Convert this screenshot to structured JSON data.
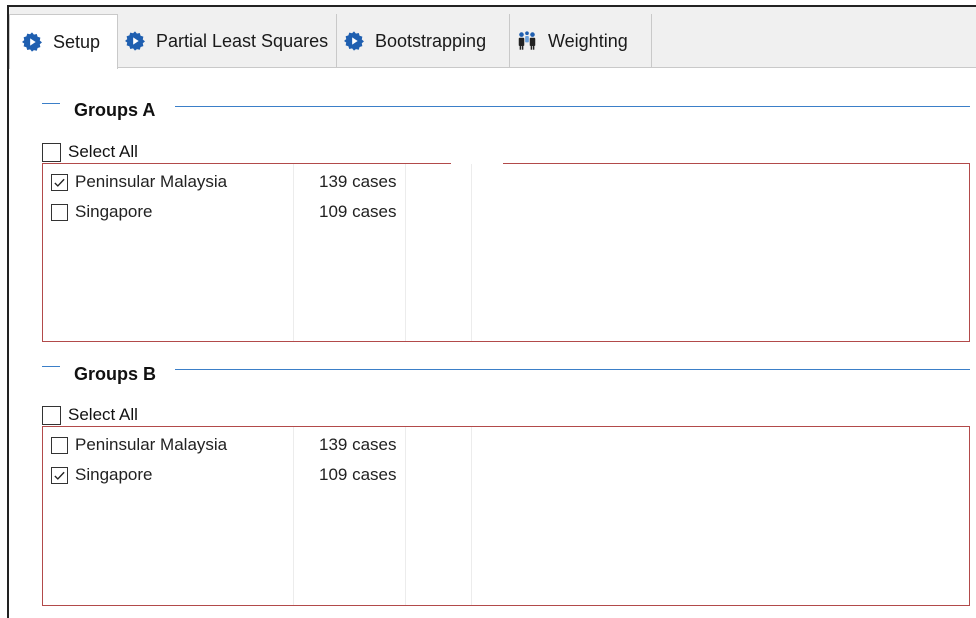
{
  "tabs": [
    {
      "label": "Setup",
      "icon": "gear-icon",
      "active": true
    },
    {
      "label": "Partial Least Squares",
      "icon": "gear-icon",
      "active": false
    },
    {
      "label": "Bootstrapping",
      "icon": "gear-icon",
      "active": false
    },
    {
      "label": "Weighting",
      "icon": "people-icon",
      "active": false
    }
  ],
  "groupsA": {
    "title": "Groups A",
    "select_all": "Select All",
    "items": [
      {
        "name": "Peninsular Malaysia",
        "cases": "139 cases",
        "checked": true
      },
      {
        "name": "Singapore",
        "cases": "109 cases",
        "checked": false
      }
    ]
  },
  "groupsB": {
    "title": "Groups B",
    "select_all": "Select All",
    "items": [
      {
        "name": "Peninsular Malaysia",
        "cases": "139 cases",
        "checked": false
      },
      {
        "name": "Singapore",
        "cases": "109 cases",
        "checked": true
      }
    ]
  },
  "colors": {
    "accent": "#1f5fb0",
    "rule": "#3b7fc8",
    "listbox_border": "#b24a4a"
  }
}
